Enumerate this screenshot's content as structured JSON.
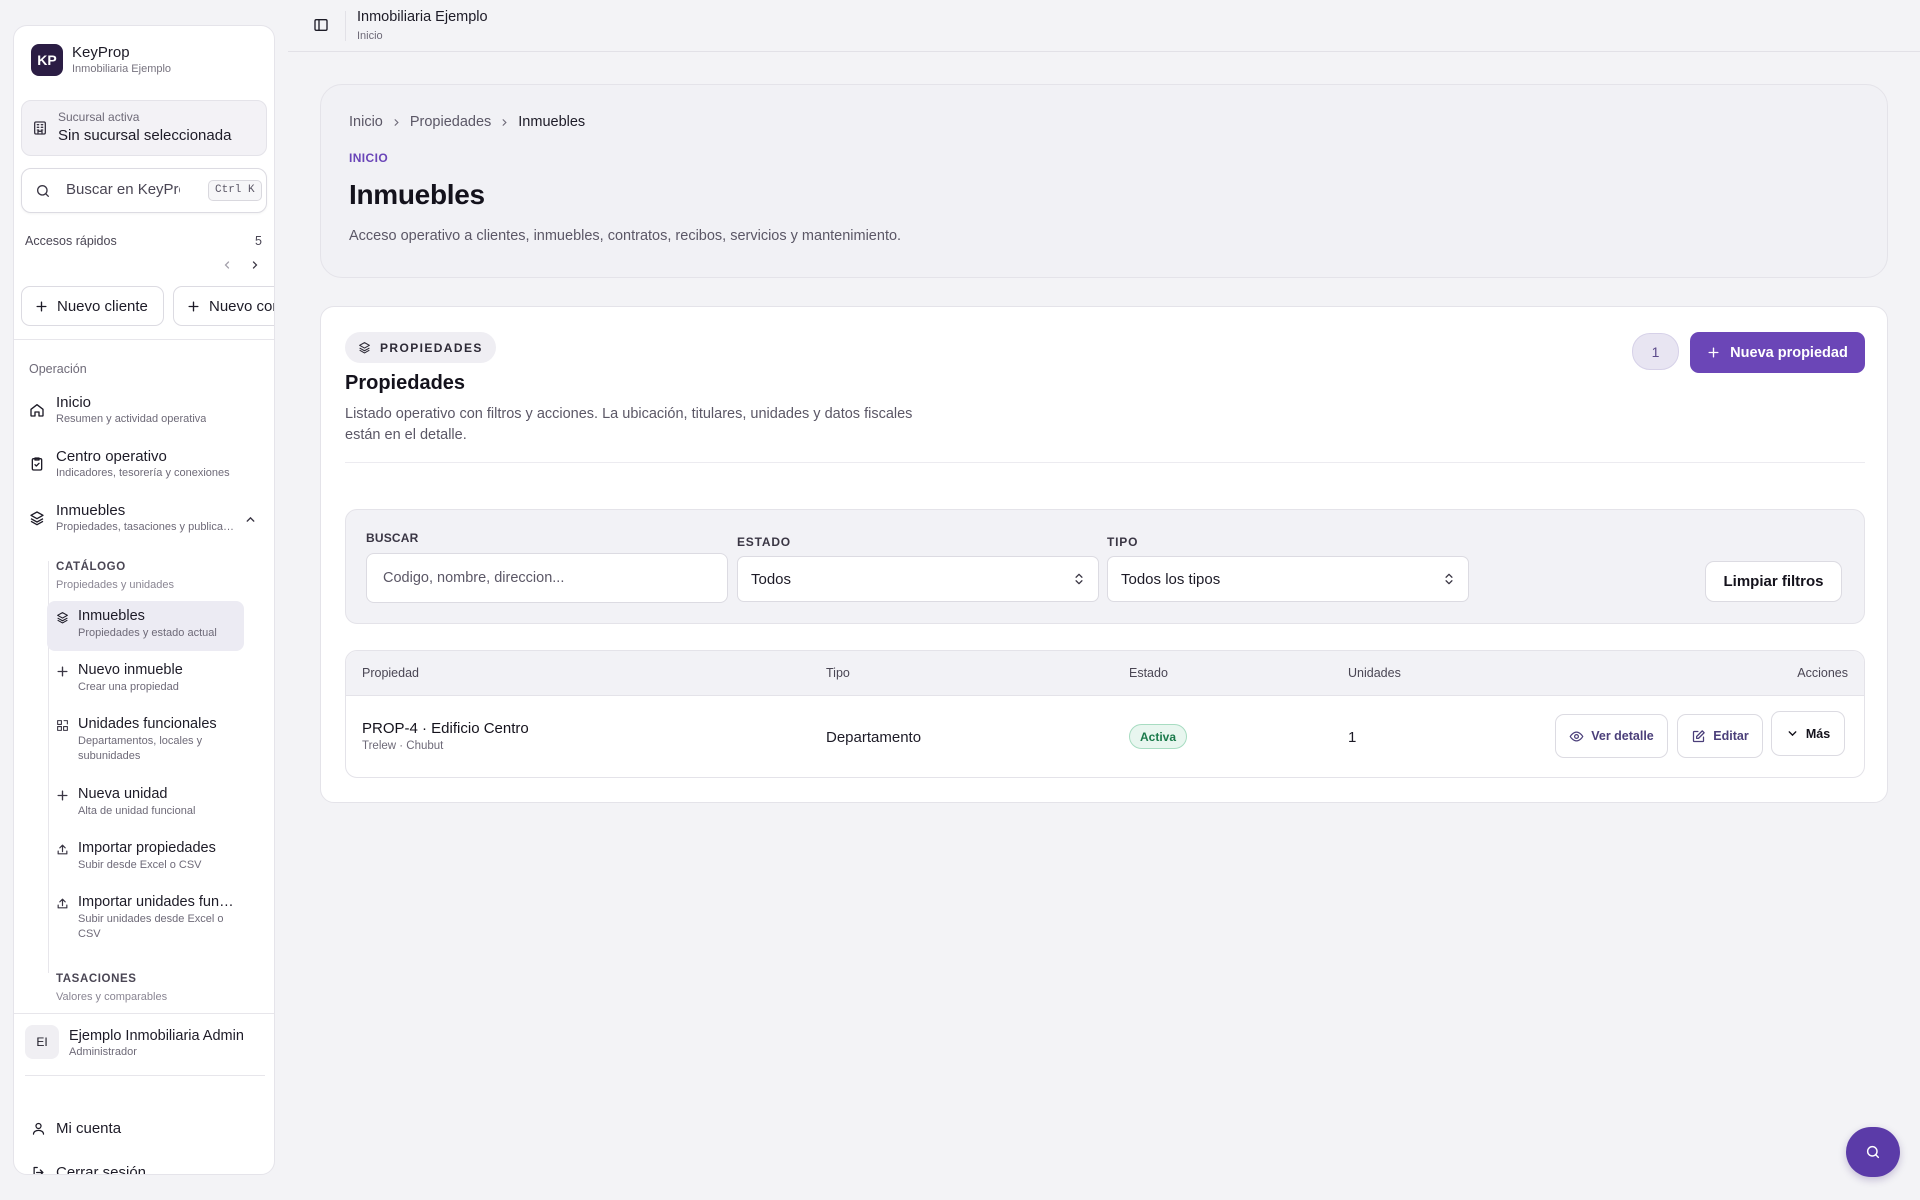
{
  "brand": {
    "logo": "KP",
    "name": "KeyProp",
    "subtitle": "Inmobiliaria Ejemplo"
  },
  "branch": {
    "label": "Sucursal activa",
    "value": "Sin sucursal seleccionada",
    "icon": "building-icon"
  },
  "search": {
    "placeholder": "Buscar en KeyProp",
    "shortcut": "Ctrl K"
  },
  "quick_access": {
    "title": "Accesos rápidos",
    "count": "5",
    "items": [
      {
        "label": "Nuevo cliente"
      },
      {
        "label": "Nuevo contrato"
      }
    ]
  },
  "nav": {
    "section": "Operación",
    "items": [
      {
        "title": "Inicio",
        "subtitle": "Resumen y actividad operativa",
        "icon": "home-icon"
      },
      {
        "title": "Centro operativo",
        "subtitle": "Indicadores, tesorería y conexiones",
        "icon": "clipboard-check-icon"
      },
      {
        "title": "Inmuebles",
        "subtitle": "Propiedades, tasaciones y publicaciones",
        "icon": "layers-icon"
      }
    ],
    "catalog": {
      "title": "CATÁLOGO",
      "subtitle": "Propiedades y unidades",
      "items": [
        {
          "title": "Inmuebles",
          "subtitle": "Propiedades y estado actual",
          "icon": "layers-icon",
          "active": true
        },
        {
          "title": "Nuevo inmueble",
          "subtitle": "Crear una propiedad",
          "icon": "plus-icon"
        },
        {
          "title": "Unidades funcionales",
          "subtitle": "Departamentos, locales y subunidades",
          "icon": "blocks-icon"
        },
        {
          "title": "Nueva unidad",
          "subtitle": "Alta de unidad funcional",
          "icon": "plus-icon"
        },
        {
          "title": "Importar propiedades",
          "subtitle": "Subir desde Excel o CSV",
          "icon": "upload-icon"
        },
        {
          "title": "Importar unidades funcionales",
          "subtitle": "Subir unidades desde Excel o CSV",
          "icon": "upload-icon"
        }
      ]
    },
    "tasaciones": {
      "title": "TASACIONES",
      "subtitle": "Valores y comparables"
    }
  },
  "user": {
    "initials": "EI",
    "name": "Ejemplo Inmobiliaria Admin",
    "role": "Administrador"
  },
  "account": {
    "my_account": "Mi cuenta",
    "logout": "Cerrar sesión"
  },
  "topbar": {
    "title": "Inmobiliaria Ejemplo",
    "subtitle": "Inicio"
  },
  "hero": {
    "breadcrumb": [
      "Inicio",
      "Propiedades",
      "Inmuebles"
    ],
    "eyebrow": "INICIO",
    "title": "Inmuebles",
    "description": "Acceso operativo a clientes, inmuebles, contratos, recibos, servicios y mantenimiento."
  },
  "card": {
    "badge": "PROPIEDADES",
    "title": "Propiedades",
    "description": "Listado operativo con filtros y acciones. La ubicación, titulares, unidades y datos fiscales están en el detalle.",
    "count": "1",
    "new_button": "Nueva propiedad"
  },
  "filters": {
    "search_label": "BUSCAR",
    "search_placeholder": "Codigo, nombre, direccion...",
    "status_label": "ESTADO",
    "status_value": "Todos",
    "type_label": "TIPO",
    "type_value": "Todos los tipos",
    "clear": "Limpiar filtros"
  },
  "table": {
    "columns": [
      "Propiedad",
      "Tipo",
      "Estado",
      "Unidades",
      "Acciones"
    ],
    "rows": [
      {
        "name": "PROP-4 · Edificio Centro",
        "location": "Trelew · Chubut",
        "type": "Departamento",
        "status": "Activa",
        "units": "1"
      }
    ],
    "actions": {
      "view": "Ver detalle",
      "edit": "Editar",
      "more": "Más"
    }
  },
  "colors": {
    "accent": "#6b46b7",
    "status_active": "#1b7a4b",
    "brand_dark": "#2b1d44"
  },
  "fab": {
    "icon": "search-icon"
  }
}
